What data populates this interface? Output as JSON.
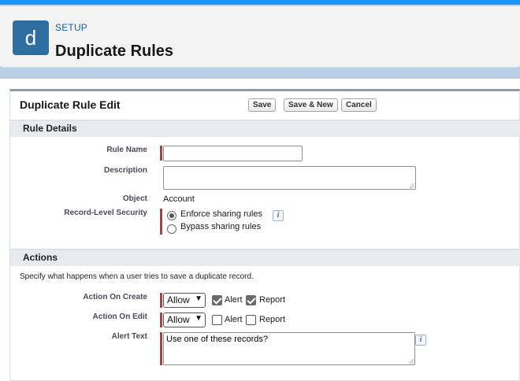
{
  "header": {
    "app_icon_letter": "d",
    "eyebrow": "SETUP",
    "title": "Duplicate Rules"
  },
  "form": {
    "title": "Duplicate Rule Edit",
    "buttons": {
      "save": "Save",
      "save_new": "Save & New",
      "cancel": "Cancel"
    }
  },
  "rule_details": {
    "section_title": "Rule Details",
    "rule_name_label": "Rule Name",
    "rule_name_value": "",
    "description_label": "Description",
    "description_value": "",
    "object_label": "Object",
    "object_value": "Account",
    "security_label": "Record-Level Security",
    "security_options": [
      {
        "label": "Enforce sharing rules",
        "selected": true
      },
      {
        "label": "Bypass sharing rules",
        "selected": false
      }
    ]
  },
  "actions": {
    "section_title": "Actions",
    "help_text": "Specify what happens when a user tries to save a duplicate record.",
    "on_create": {
      "label": "Action On Create",
      "value": "Allow",
      "alert_label": "Alert",
      "alert_checked": true,
      "report_label": "Report",
      "report_checked": true
    },
    "on_edit": {
      "label": "Action On Edit",
      "value": "Allow",
      "alert_label": "Alert",
      "alert_checked": false,
      "report_label": "Report",
      "report_checked": false
    },
    "alert_text_label": "Alert Text",
    "alert_text_value": "Use one of these records?"
  },
  "icons": {
    "info": "info-icon",
    "dropdown": "chevron-down-icon"
  },
  "colors": {
    "brand_blue": "#1b96ff",
    "app_icon": "#2e6ea0",
    "required_bar": "#c23934",
    "section_bar": "#e8eaf0"
  }
}
